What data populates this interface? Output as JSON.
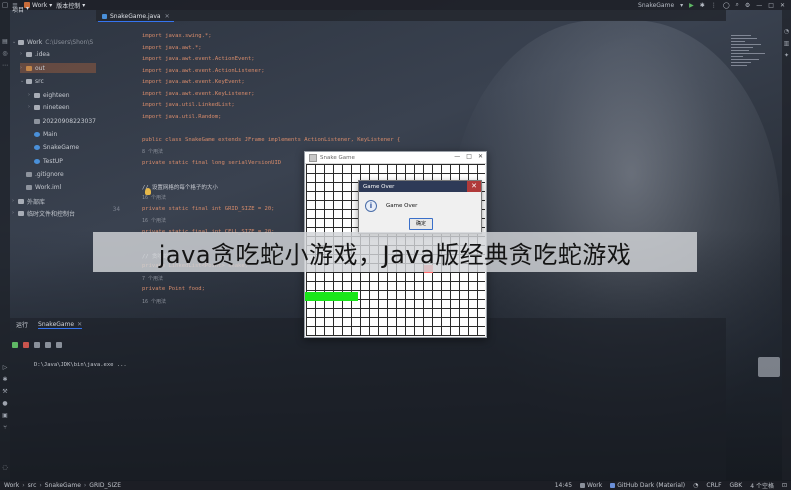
{
  "titlebar": {
    "project": "Work",
    "vcs": "版本控制",
    "run_config": "SnakeGame",
    "run_config_chevron": "▾"
  },
  "editor_tab": {
    "label": "SnakeGame.java"
  },
  "project_panel": {
    "header": "项目",
    "items": [
      {
        "label": "Work",
        "path": "C:\\Users\\Shon\\S",
        "level": 0,
        "kind": "folder",
        "open": true
      },
      {
        "label": ".idea",
        "level": 1,
        "kind": "folder"
      },
      {
        "label": "out",
        "level": 1,
        "kind": "folder-orange",
        "selected": true
      },
      {
        "label": "src",
        "level": 1,
        "kind": "folder",
        "open": true
      },
      {
        "label": "eighteen",
        "level": 2,
        "kind": "folder"
      },
      {
        "label": "nineteen",
        "level": 2,
        "kind": "folder"
      },
      {
        "label": "20220908223037",
        "level": 2,
        "kind": "file"
      },
      {
        "label": "Main",
        "level": 2,
        "kind": "class"
      },
      {
        "label": "SnakeGame",
        "level": 2,
        "kind": "class"
      },
      {
        "label": "TestUP",
        "level": 2,
        "kind": "class"
      },
      {
        "label": ".gitignore",
        "level": 1,
        "kind": "file"
      },
      {
        "label": "Work.iml",
        "level": 1,
        "kind": "file"
      },
      {
        "label": "外部库",
        "level": 0,
        "kind": "folder"
      },
      {
        "label": "临时文件和控制台",
        "level": 0,
        "kind": "folder"
      }
    ]
  },
  "code": {
    "lines": [
      {
        "n": "",
        "text": "import javax.swing.*;"
      },
      {
        "n": "",
        "text": "import java.awt.*;"
      },
      {
        "n": "",
        "text": "import java.awt.event.ActionEvent;"
      },
      {
        "n": "",
        "text": "import java.awt.event.ActionListener;"
      },
      {
        "n": "",
        "text": "import java.awt.event.KeyEvent;"
      },
      {
        "n": "",
        "text": "import java.awt.event.KeyListener;"
      },
      {
        "n": "",
        "text": "import java.util.LinkedList;"
      },
      {
        "n": "",
        "text": "import java.util.Random;"
      },
      {
        "n": "",
        "text": ""
      },
      {
        "n": "",
        "text": "public class SnakeGame extends JFrame implements ActionListener, KeyListener {"
      },
      {
        "n": "",
        "text": "    8 个用法"
      },
      {
        "n": "",
        "text": "    private static final long serialVersionUID"
      },
      {
        "n": "",
        "text": ""
      },
      {
        "n": "",
        "text": "    // 设置网格的每个格子的大小"
      },
      {
        "n": "",
        "text": "    16 个用法"
      },
      {
        "n": "34",
        "text": "    private static final int GRID_SIZE = 20;"
      },
      {
        "n": "",
        "text": "    16 个用法"
      },
      {
        "n": "",
        "text": "    private static final int CELL_SIZE = 20;"
      },
      {
        "n": "",
        "text": ""
      },
      {
        "n": "",
        "text": "    // 贪吃蛇身体"
      },
      {
        "n": "",
        "text": "    private LinkedList<Point> snake;"
      },
      {
        "n": "",
        "text": "    7 个用法"
      },
      {
        "n": "",
        "text": "    private Point food;"
      },
      {
        "n": "",
        "text": "    16 个用法"
      }
    ]
  },
  "game_window": {
    "title": "Snake Game",
    "controls": [
      "—",
      "□",
      "✕"
    ]
  },
  "dialog": {
    "title": "Game Over",
    "close": "✕",
    "info_glyph": "i",
    "message": "Game Over",
    "ok_label": "确定"
  },
  "banner": {
    "text": "java贪吃蛇小游戏，Java版经典贪吃蛇游戏"
  },
  "run_panel": {
    "tabs": [
      {
        "label": "运行",
        "active": false
      },
      {
        "label": "SnakeGame",
        "active": true,
        "close": "✕"
      }
    ],
    "console": "D:\\Java\\JDK\\bin\\java.exe ..."
  },
  "statusbar": {
    "crumbs": [
      "Work",
      "src",
      "SnakeGame",
      "GRID_SIZE"
    ],
    "line_col": "14:45",
    "branch": "Work",
    "theme": "GitHub Dark (Material)",
    "line_sep": "CRLF",
    "encoding": "GBK",
    "indent": "4 个空格"
  },
  "colors": {
    "accent": "#3574f0",
    "snake": "#19e619",
    "food": "#ff6a6a",
    "dialog_title": "#2e3a57"
  }
}
